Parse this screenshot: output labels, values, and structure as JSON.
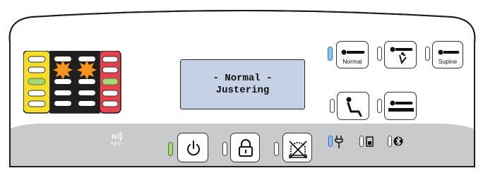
{
  "display": {
    "line1": "- Normal -",
    "line2": "Justering"
  },
  "position_buttons": {
    "normal": {
      "label": "Normal",
      "led_state": "on"
    },
    "tilt": {
      "led_state": "off"
    },
    "supine": {
      "label": "Supine",
      "led_state": "off"
    },
    "sit_up": {
      "led_state": "off"
    },
    "flat": {
      "led_state": "off"
    }
  },
  "bottom_bar": {
    "nfc_label": "NFC",
    "power_led": "on",
    "lock_led": "off",
    "mute_led": "off",
    "power_led_state": "on"
  },
  "status_icons": {
    "mains_plug": "on",
    "battery": "off",
    "bluetooth": "off"
  },
  "pressure_indicator": {
    "left_column_colors": [
      "white",
      "white",
      "green",
      "white",
      "white"
    ],
    "middle_left_colors": [
      "white",
      "star",
      "white",
      "white",
      "white"
    ],
    "middle_right_colors": [
      "white",
      "star",
      "white",
      "white",
      "white"
    ],
    "right_column_colors": [
      "white",
      "white",
      "green",
      "white",
      "white"
    ]
  },
  "colors": {
    "bar_bg": "#c9cacc",
    "yellow": "#f5dd2a",
    "black": "#1f1f1f",
    "red": "#e5424d",
    "green_led": "#a9d678",
    "blue_led": "#8fc8f2",
    "lcd": "#c6d1e6",
    "star": "#f7941d"
  },
  "icons": [
    "nfc-icon",
    "power-icon",
    "lock-icon",
    "alarm-mute-icon",
    "plug-icon",
    "battery-icon",
    "bluetooth-icon"
  ]
}
